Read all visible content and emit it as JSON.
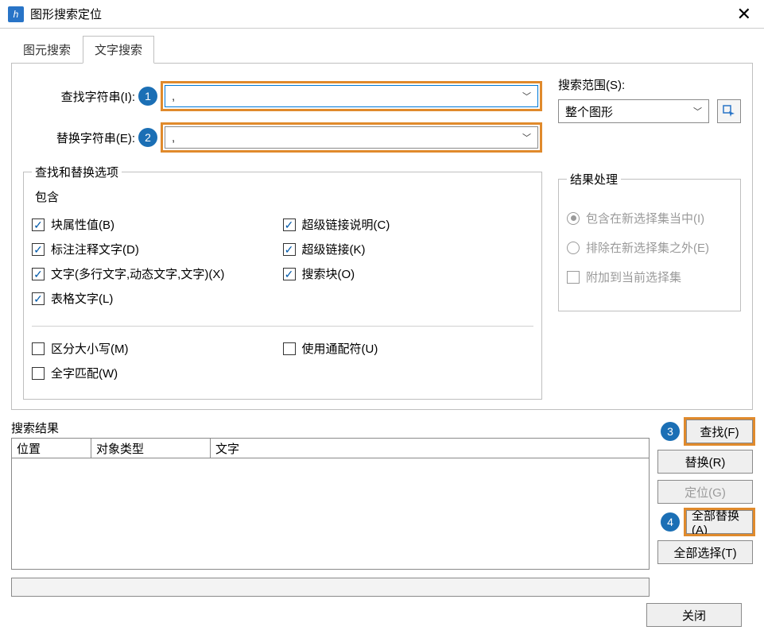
{
  "window": {
    "title": "图形搜索定位"
  },
  "tabs": {
    "primitive": "图元搜索",
    "text": "文字搜索"
  },
  "fields": {
    "findLabel": "查找字符串(I):",
    "replaceLabel": "替换字符串(E):",
    "findValue": ",",
    "replaceValue": ","
  },
  "optionsGroup": "查找和替换选项",
  "includeLabel": "包含",
  "options": {
    "blockAttr": "块属性值(B)",
    "dimText": "标注注释文字(D)",
    "textTypes": "文字(多行文字,动态文字,文字)(X)",
    "tableText": "表格文字(L)",
    "hyperDesc": "超级链接说明(C)",
    "hyperlink": "超级链接(K)",
    "searchBlock": "搜索块(O)",
    "matchCase": "区分大小写(M)",
    "wholeWord": "全字匹配(W)",
    "wildcard": "使用通配符(U)"
  },
  "scope": {
    "label": "搜索范围(S):",
    "value": "整个图形"
  },
  "resultHandling": {
    "legend": "结果处理",
    "include": "包含在新选择集当中(I)",
    "exclude": "排除在新选择集之外(E)",
    "append": "附加到当前选择集"
  },
  "results": {
    "legend": "搜索结果",
    "cols": {
      "pos": "位置",
      "type": "对象类型",
      "text": "文字"
    }
  },
  "buttons": {
    "find": "查找(F)",
    "replace": "替换(R)",
    "locate": "定位(G)",
    "replaceAll": "全部替换(A)",
    "selectAll": "全部选择(T)",
    "close": "关闭"
  },
  "callouts": {
    "c1": "1",
    "c2": "2",
    "c3": "3",
    "c4": "4"
  }
}
